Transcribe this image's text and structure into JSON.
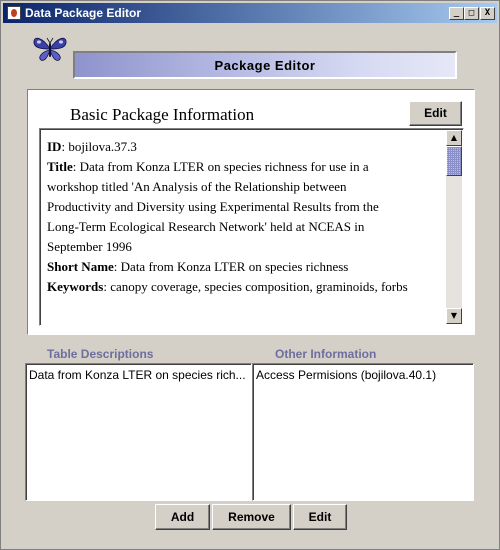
{
  "window": {
    "title": "Data Package Editor",
    "controls": {
      "minimize": "_",
      "maximize": "□",
      "close": "X"
    }
  },
  "banner": {
    "title": "Package Editor"
  },
  "basic_info": {
    "heading": "Basic Package Information",
    "edit_label": "Edit",
    "fields": {
      "id_label": "ID",
      "id_value": ": bojilova.37.3",
      "title_label": "Title",
      "title_lines": [
        ": Data from Konza LTER on species richness for use in a",
        "workshop titled 'An Analysis of the Relationship between",
        "Productivity and Diversity using Experimental Results from the",
        "Long-Term Ecological Research Network' held at NCEAS in",
        "September 1996"
      ],
      "short_name_label": "Short Name",
      "short_name_value": ": Data from Konza LTER on species richness",
      "keywords_label": "Keywords",
      "keywords_value": ": canopy coverage, species composition, graminoids, forbs"
    }
  },
  "table_descriptions": {
    "label": "Table Descriptions",
    "items": [
      "Data from Konza LTER on species rich..."
    ]
  },
  "other_information": {
    "label": "Other Information",
    "items": [
      "Access Permisions (bojilova.40.1)"
    ]
  },
  "actions": {
    "add": "Add",
    "remove": "Remove",
    "edit": "Edit"
  },
  "icons": {
    "app": "java-cup-icon",
    "logo": "butterfly-icon"
  }
}
